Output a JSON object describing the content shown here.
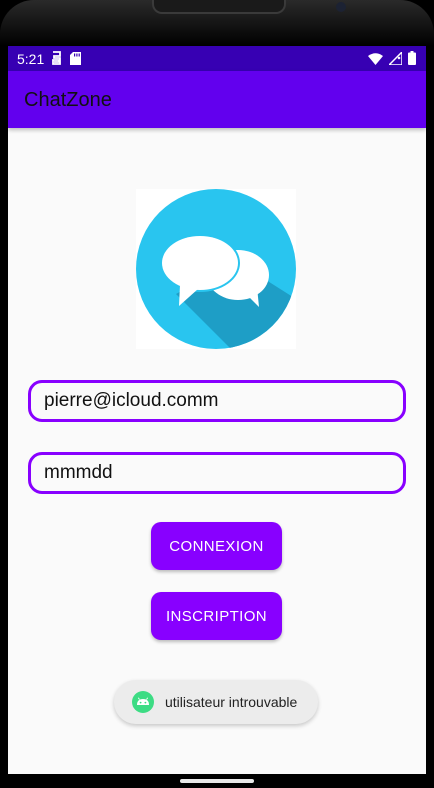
{
  "status_bar": {
    "time": "5:21"
  },
  "app_bar": {
    "title": "ChatZone"
  },
  "form": {
    "email_value": "pierre@icloud.comm",
    "password_value": "mmmdd"
  },
  "buttons": {
    "login_label": "CONNEXION",
    "register_label": "INSCRIPTION"
  },
  "toast": {
    "message": "utilisateur introuvable"
  },
  "colors": {
    "status_bar": "#3700b3",
    "app_bar": "#6200ee",
    "accent": "#8800ff",
    "logo_circle": "#29c5ef",
    "logo_shadow": "#1e9ec6"
  },
  "icons": [
    "sim-card-icon",
    "sd-card-icon",
    "wifi-icon",
    "signal-icon",
    "battery-icon",
    "chat-bubbles-icon",
    "android-icon"
  ]
}
